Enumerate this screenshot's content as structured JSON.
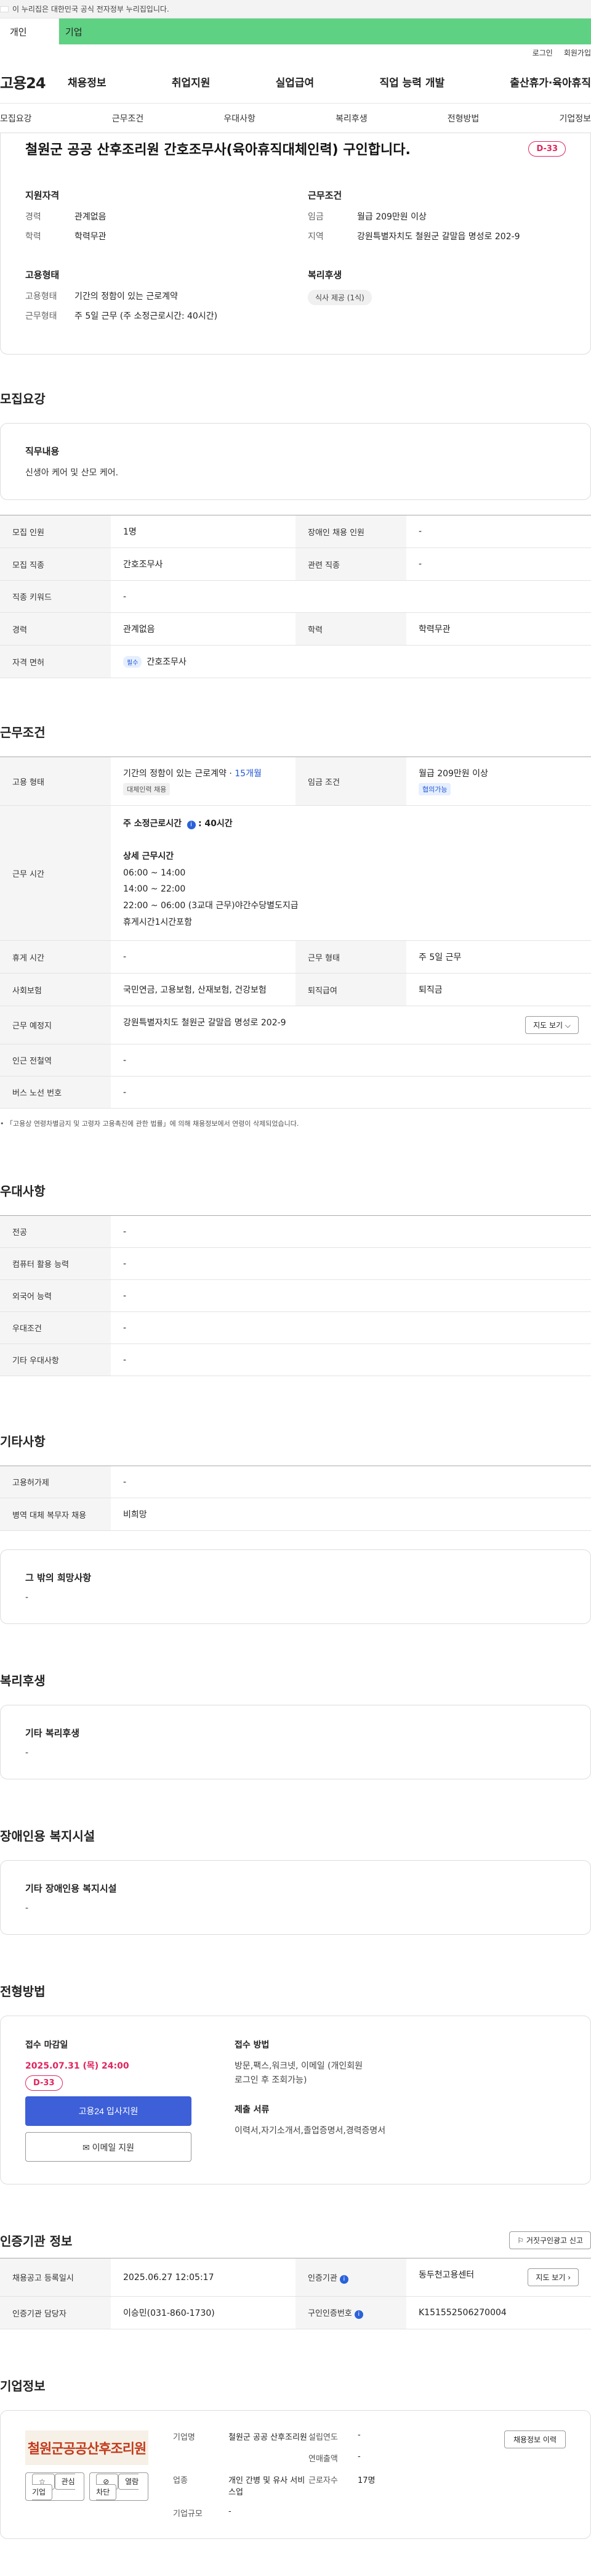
{
  "banner": {
    "text": "이 누리집은 대한민국 공식 전자정부 누리집입니다."
  },
  "tabs": {
    "personal": "개인",
    "company": "기업"
  },
  "util": {
    "login": "로그인",
    "signup": "회원가입"
  },
  "logo": "고용24",
  "gnb": [
    "채용정보",
    "취업지원",
    "실업급여",
    "직업 능력 개발",
    "출산휴가·육아휴직"
  ],
  "anchors": [
    "모집요강",
    "근무조건",
    "우대사항",
    "복리후생",
    "전형방법",
    "기업정보"
  ],
  "summary": {
    "title": "철원군 공공 산후조리원 간호조무사(육아휴직대체인력) 구인합니다.",
    "dday": "D-33",
    "qual_title": "지원자격",
    "qual": [
      {
        "k": "경력",
        "v": "관계없음"
      },
      {
        "k": "학력",
        "v": "학력무관"
      }
    ],
    "cond_title": "근무조건",
    "cond": [
      {
        "k": "임금",
        "v": "월급 209만원 이상"
      },
      {
        "k": "지역",
        "v": "강원특별자치도 철원군 갈말읍 명성로 202-9"
      }
    ],
    "emp_title": "고용형태",
    "emp": [
      {
        "k": "고용형태",
        "v": "기간의 정함이 있는 근로계약"
      },
      {
        "k": "근무형태",
        "v": "주 5일 근무 (주 소정근로시간: 40시간)"
      }
    ],
    "welfare_title": "복리후생",
    "welfare_pill": "식사 제공 (1식)"
  },
  "recruit": {
    "title": "모집요강",
    "duty_title": "직무내용",
    "duty": "신생아 케어 및 산모 케어.",
    "rows": {
      "headcount_k": "모집 인원",
      "headcount_v": "1명",
      "disabled_k": "장애인 채용 인원",
      "disabled_v": "-",
      "job_k": "모집 직종",
      "job_v": "간호조무사",
      "related_k": "관련 직종",
      "related_v": "-",
      "keyword_k": "직종 키워드",
      "keyword_v": "-",
      "career_k": "경력",
      "career_v": "관계없음",
      "edu_k": "학력",
      "edu_v": "학력무관",
      "license_k": "자격 면허",
      "license_tag": "필수",
      "license_v": "간호조무사"
    }
  },
  "work": {
    "title": "근무조건",
    "emp_k": "고용 형태",
    "emp_v": "기간의 정함이 있는 근로계약 · ",
    "emp_months": "15개월",
    "emp_tag": "대체인력 채용",
    "wage_k": "임금 조건",
    "wage_v": "월급 209만원 이상",
    "wage_tag": "협의가능",
    "hours_k": "근무 시간",
    "hours_main": "주 소정근로시간",
    "hours_main_v": ": 40시간",
    "hours_detail_title": "상세 근무시간",
    "hours_lines": [
      "06:00 ~ 14:00",
      "14:00 ~ 22:00",
      "22:00 ~ 06:00 (3교대 근무)야간수당별도지급",
      "휴게시간1시간포함"
    ],
    "rest_k": "휴게 시간",
    "rest_v": "-",
    "form_k": "근무 형태",
    "form_v": "주 5일 근무",
    "ins_k": "사회보험",
    "ins_v": "국민연금, 고용보험, 산재보험, 건강보험",
    "retire_k": "퇴직급여",
    "retire_v": "퇴직금",
    "place_k": "근무 예정지",
    "place_v": "강원특별자치도 철원군 갈말읍 명성로 202-9",
    "map_btn": "지도 보기 ⌵",
    "subway_k": "인근 전철역",
    "subway_v": "-",
    "bus_k": "버스 노선 번호",
    "bus_v": "-",
    "note": "「고용상 연령차별금지 및 고령자 고용촉진에 관한 법률」에 의해 채용정보에서 연령이 삭제되었습니다."
  },
  "pref": {
    "title": "우대사항",
    "rows": [
      {
        "k": "전공",
        "v": "-"
      },
      {
        "k": "컴퓨터 활용 능력",
        "v": "-"
      },
      {
        "k": "외국어 능력",
        "v": "-"
      },
      {
        "k": "우대조건",
        "v": "-"
      },
      {
        "k": "기타 우대사항",
        "v": "-"
      }
    ]
  },
  "etc": {
    "title": "기타사항",
    "rows": [
      {
        "k": "고용허가제",
        "v": "-"
      },
      {
        "k": "병역 대체 복무자 채용",
        "v": "비희망"
      }
    ],
    "other_title": "그 밖의 희망사항",
    "other_v": "-"
  },
  "welfare": {
    "title": "복리후생",
    "box_title": "기타 복리후생",
    "box_v": "-"
  },
  "disabled": {
    "title": "장애인용 복지시설",
    "box_title": "기타 장애인용 복지시설",
    "box_v": "-"
  },
  "apply": {
    "title": "전형방법",
    "deadline_title": "접수 마감일",
    "deadline": "2025.07.31 (목) 24:00",
    "dday": "D-33",
    "btn_apply": "고용24 입사지원",
    "btn_email": "이메일 지원",
    "method_title": "접수 방법",
    "method_v": "방문,팩스,워크넷, 이메일 (개인회원 로그인 후 조회가능)",
    "docs_title": "제출 서류",
    "docs_v": "이력서,자기소개서,졸업증명서,경력증명서"
  },
  "agency": {
    "title": "인증기관 정보",
    "report_btn": "거짓구인광고 신고",
    "reg_k": "채용공고 등록일시",
    "reg_v": "2025.06.27 12:05:17",
    "org_k": "인증기관",
    "org_v": "동두천고용센터",
    "map_btn": "지도 보기 ›",
    "mgr_k": "인증기관 담당자",
    "mgr_v": "이승민(031-860-1730)",
    "no_k": "구인인증번호",
    "no_v": "K151552506270004"
  },
  "company": {
    "title": "기업정보",
    "logo_text": "철원군공공산후조리원",
    "fav_btn": "관심기업",
    "block_btn": "열람차단",
    "history_btn": "채용정보 이력",
    "name_k": "기업명",
    "name_v": "철원군 공공 산후조리원",
    "year_k": "설립연도",
    "year_v": "-",
    "sales_k": "연매출액",
    "sales_v": "-",
    "biz_k": "업종",
    "biz_v": "개인 간병 및 유사 서비스업",
    "emp_k": "근로자수",
    "emp_v": "17명",
    "scale_k": "기업규모",
    "scale_v": "-"
  }
}
